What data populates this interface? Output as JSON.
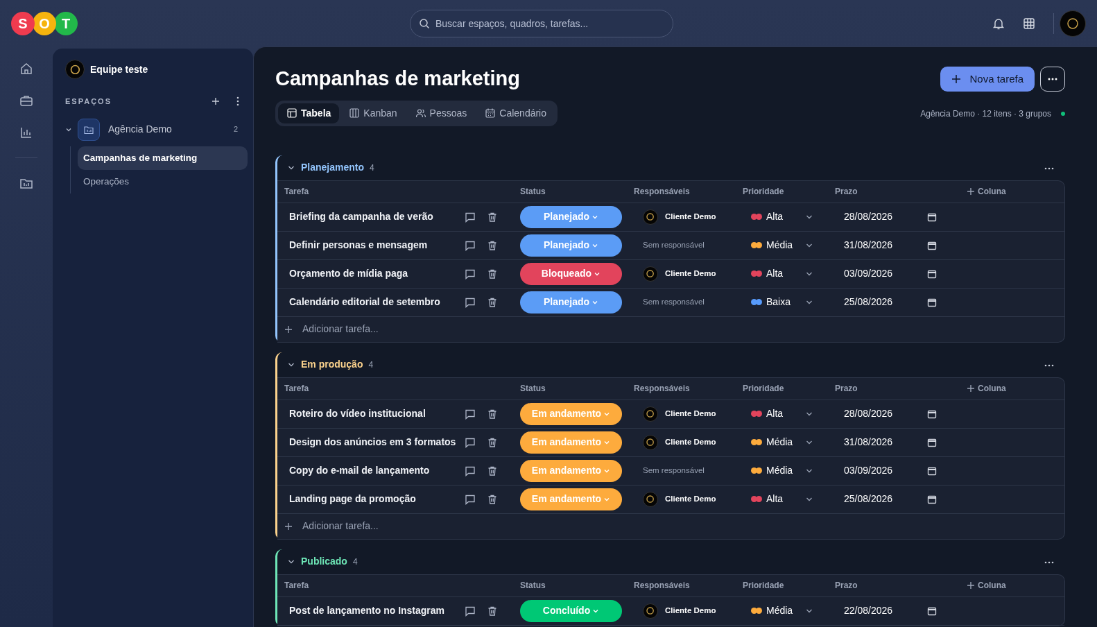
{
  "topbar": {
    "logo": [
      {
        "letter": "S",
        "color": "#ef3b4f"
      },
      {
        "letter": "O",
        "color": "#f6b40e"
      },
      {
        "letter": "T",
        "color": "#22b84a"
      }
    ],
    "search": {
      "placeholder": "Buscar espaços, quadros, tarefas..."
    }
  },
  "sidebar": {
    "team": "Equipe teste",
    "section_label": "ESPAÇOS",
    "spaces": [
      {
        "name": "Agência Demo",
        "count": "2",
        "expanded": true,
        "children": [
          {
            "name": "Campanhas de marketing",
            "selected": true
          },
          {
            "name": "Operações",
            "selected": false
          }
        ]
      }
    ]
  },
  "main": {
    "title": "Campanhas de marketing",
    "new_task_button": "Nova tarefa",
    "views": [
      {
        "label": "Tabela",
        "kind": "table",
        "selected": true
      },
      {
        "label": "Kanban",
        "kind": "kanban",
        "selected": false
      },
      {
        "label": "Pessoas",
        "kind": "people",
        "selected": false
      },
      {
        "label": "Calendário",
        "kind": "calendar",
        "selected": false
      }
    ],
    "meta": "Agência Demo · 12 itens · 3 grupos",
    "online": true,
    "groups": [
      {
        "title": "Planejamento",
        "count": "4",
        "color": "#93c5fd",
        "expanded": true,
        "columns": [
          "Tarefa",
          "Status",
          "Responsáveis",
          "Prioridade",
          "Prazo",
          "Coluna"
        ],
        "add_label": "Adicionar tarefa...",
        "rows": [
          {
            "task": "Briefing da campanha de verão",
            "status": {
              "label": "Planejado",
              "color": "#5b9cf6"
            },
            "assignee": {
              "name": "Cliente Demo",
              "assigned": true
            },
            "priority": {
              "label": "Alta",
              "color": "#e2445c"
            },
            "due": "28/08/2026"
          },
          {
            "task": "Definir personas e mensagem",
            "status": {
              "label": "Planejado",
              "color": "#5b9cf6"
            },
            "assignee": {
              "name": "Sem responsável",
              "assigned": false
            },
            "priority": {
              "label": "Média",
              "color": "#fdab3d"
            },
            "due": "31/08/2026"
          },
          {
            "task": "Orçamento de mídia paga",
            "status": {
              "label": "Bloqueado",
              "color": "#e2445c"
            },
            "assignee": {
              "name": "Cliente Demo",
              "assigned": true
            },
            "priority": {
              "label": "Alta",
              "color": "#e2445c"
            },
            "due": "03/09/2026"
          },
          {
            "task": "Calendário editorial de setembro",
            "status": {
              "label": "Planejado",
              "color": "#5b9cf6"
            },
            "assignee": {
              "name": "Sem responsável",
              "assigned": false
            },
            "priority": {
              "label": "Baixa",
              "color": "#579bfc"
            },
            "due": "25/08/2026"
          }
        ]
      },
      {
        "title": "Em produção",
        "count": "4",
        "color": "#fcd38d",
        "expanded": true,
        "columns": [
          "Tarefa",
          "Status",
          "Responsáveis",
          "Prioridade",
          "Prazo",
          "Coluna"
        ],
        "add_label": "Adicionar tarefa...",
        "rows": [
          {
            "task": "Roteiro do vídeo institucional",
            "status": {
              "label": "Em andamento",
              "color": "#fdab3d"
            },
            "assignee": {
              "name": "Cliente Demo",
              "assigned": true
            },
            "priority": {
              "label": "Alta",
              "color": "#e2445c"
            },
            "due": "28/08/2026"
          },
          {
            "task": "Design dos anúncios em 3 formatos",
            "status": {
              "label": "Em andamento",
              "color": "#fdab3d"
            },
            "assignee": {
              "name": "Cliente Demo",
              "assigned": true
            },
            "priority": {
              "label": "Média",
              "color": "#fdab3d"
            },
            "due": "31/08/2026"
          },
          {
            "task": "Copy do e-mail de lançamento",
            "status": {
              "label": "Em andamento",
              "color": "#fdab3d"
            },
            "assignee": {
              "name": "Sem responsável",
              "assigned": false
            },
            "priority": {
              "label": "Média",
              "color": "#fdab3d"
            },
            "due": "03/09/2026"
          },
          {
            "task": "Landing page da promoção",
            "status": {
              "label": "Em andamento",
              "color": "#fdab3d"
            },
            "assignee": {
              "name": "Cliente Demo",
              "assigned": true
            },
            "priority": {
              "label": "Alta",
              "color": "#e2445c"
            },
            "due": "25/08/2026"
          }
        ]
      },
      {
        "title": "Publicado",
        "count": "4",
        "color": "#6ee7b7",
        "expanded": true,
        "columns": [
          "Tarefa",
          "Status",
          "Responsáveis",
          "Prioridade",
          "Prazo",
          "Coluna"
        ],
        "rows": [
          {
            "task": "Post de lançamento no Instagram",
            "status": {
              "label": "Concluído",
              "color": "#00c875"
            },
            "assignee": {
              "name": "Cliente Demo",
              "assigned": true
            },
            "priority": {
              "label": "Média",
              "color": "#fdab3d"
            },
            "due": "22/08/2026"
          }
        ]
      }
    ]
  }
}
